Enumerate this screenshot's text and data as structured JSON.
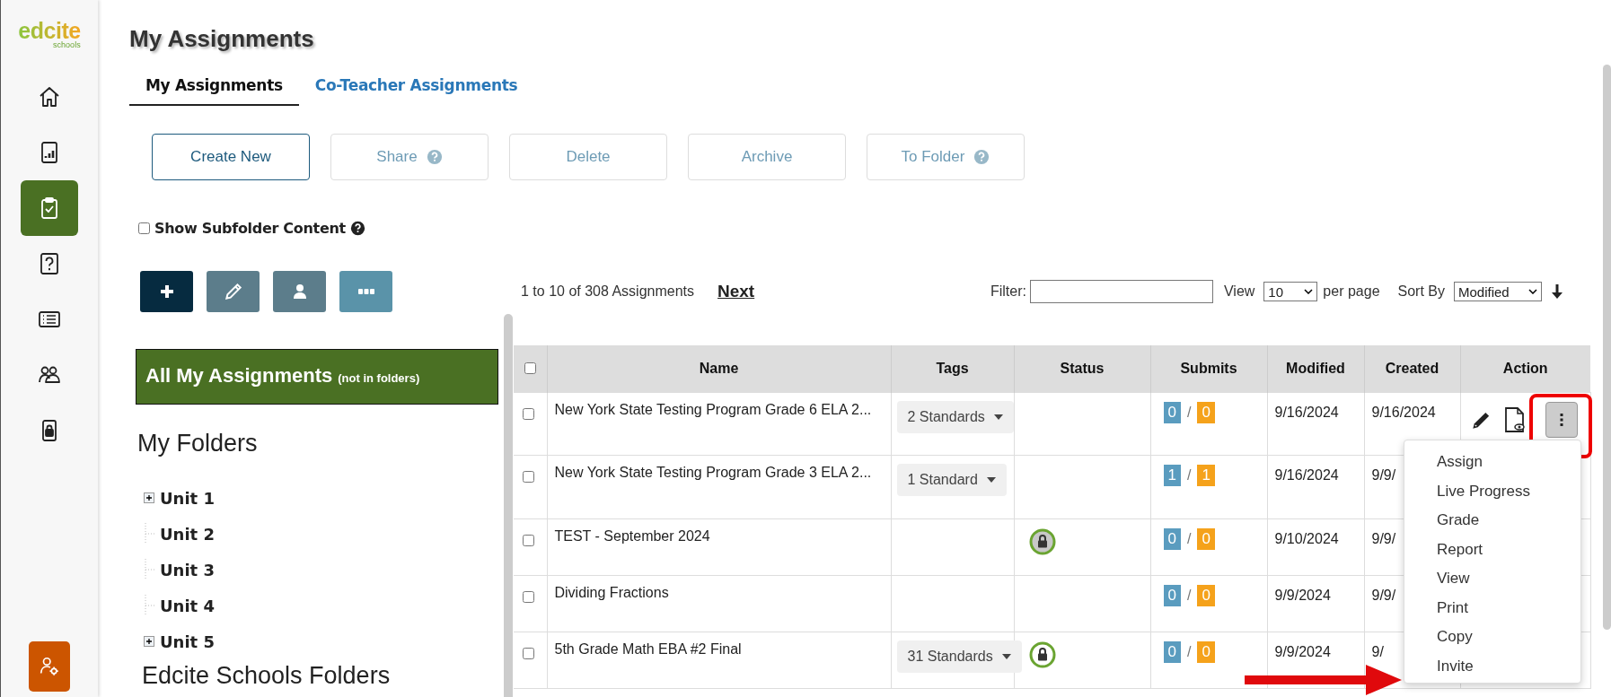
{
  "logo": {
    "name": "edcite",
    "tagline": "schools"
  },
  "sidebar": {
    "items": [
      {
        "selected": false
      },
      {
        "selected": false
      },
      {
        "selected": true
      },
      {
        "selected": false
      },
      {
        "selected": false
      },
      {
        "selected": false
      },
      {
        "selected": false
      }
    ]
  },
  "page_title": "My Assignments",
  "tabs": [
    {
      "label": "My Assignments",
      "selected": true
    },
    {
      "label": "Co-Teacher Assignments",
      "selected": false
    }
  ],
  "toolbar_buttons": [
    {
      "label": "Create New",
      "disabled": false,
      "help": false
    },
    {
      "label": "Share",
      "disabled": true,
      "help": true
    },
    {
      "label": "Delete",
      "disabled": true,
      "help": false
    },
    {
      "label": "Archive",
      "disabled": true,
      "help": false
    },
    {
      "label": "To Folder",
      "disabled": true,
      "help": true
    }
  ],
  "subfolder_option": {
    "label": "Show Subfolder Content",
    "checked": false
  },
  "all_assignments": {
    "label": "All My Assignments",
    "note": "(not in folders)",
    "selected": true
  },
  "my_folders": {
    "title": "My Folders",
    "items": [
      {
        "label": "Unit 1",
        "kind": "collapsed"
      },
      {
        "label": "Unit 2",
        "kind": "leaf"
      },
      {
        "label": "Unit 3",
        "kind": "leaf"
      },
      {
        "label": "Unit 4",
        "kind": "leaf"
      },
      {
        "label": "Unit 5",
        "kind": "collapsed"
      }
    ]
  },
  "shared_folders": {
    "title": "Edcite Schools Folders"
  },
  "pagination": {
    "summary": "1 to 10 of 308 Assignments",
    "next": "Next"
  },
  "filter": {
    "label": "Filter:"
  },
  "view": {
    "label": "View",
    "value": "10",
    "suffix": "per page"
  },
  "sort": {
    "label": "Sort By",
    "value": "Modified"
  },
  "table": {
    "select_all_checked": false,
    "columns": [
      "Name",
      "Tags",
      "Status",
      "Submits",
      "Modified",
      "Created",
      "Action"
    ],
    "rows": [
      {
        "checked": false,
        "name": "New York State Testing Program Grade 6 ELA 2...",
        "tags": "2 Standards",
        "locked": false,
        "submitted": "0",
        "slash": "/",
        "total": "0",
        "modified": "9/16/2024",
        "created": "9/16/2024",
        "menu_open": true
      },
      {
        "checked": false,
        "name": "New York State Testing Program Grade 3 ELA 2...",
        "tags": "1 Standard",
        "locked": false,
        "submitted": "1",
        "slash": "/",
        "total": "1",
        "modified": "9/16/2024",
        "created": "9/9/",
        "menu_open": false
      },
      {
        "checked": false,
        "name": "TEST - September 2024",
        "locked": true,
        "shaded": true,
        "submitted": "0",
        "slash": "/",
        "total": "0",
        "modified": "9/10/2024",
        "created": "9/9/",
        "menu_open": false
      },
      {
        "checked": false,
        "name": "Dividing Fractions",
        "locked": false,
        "submitted": "0",
        "slash": "/",
        "total": "0",
        "modified": "9/9/2024",
        "created": "9/9/",
        "menu_open": false
      },
      {
        "checked": false,
        "name": "5th Grade Math EBA #2 Final",
        "tags": "31 Standards",
        "locked": true,
        "shaded": false,
        "submitted": "0",
        "slash": "/",
        "total": "0",
        "modified": "9/9/2024",
        "created": "9/",
        "menu_open": false
      }
    ],
    "action_menu": [
      "Assign",
      "Live Progress",
      "Grade",
      "Report",
      "View",
      "Print",
      "Copy",
      "Invite"
    ]
  }
}
